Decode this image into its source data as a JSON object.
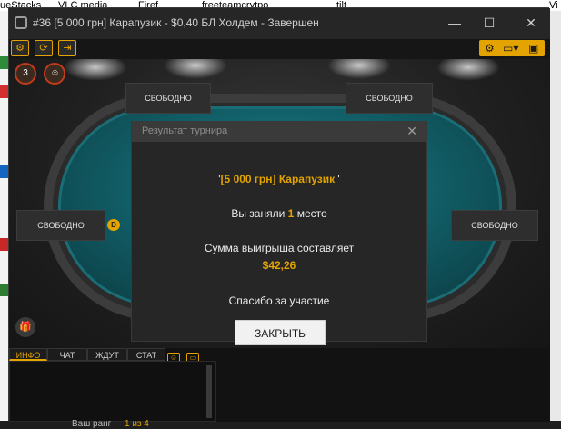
{
  "desktop": {
    "taskbar_items": [
      "ueStacks",
      "VLC media",
      "Firef",
      "freeteamcrytpo",
      "tilt",
      "Vi"
    ]
  },
  "window": {
    "title": "#36 [5 000 грн] Карапузик  - $0,40 БЛ Холдем - Завершен",
    "minimize": "—",
    "maximize": "☐",
    "close": "✕"
  },
  "toolbar": {
    "left_icons": [
      "gear-icon",
      "refresh-icon",
      "exit-icon"
    ],
    "right_icons": [
      "settings-icon",
      "layout-icon",
      "window-icon"
    ],
    "left_glyphs": [
      "⚙",
      "⟳",
      "⇥"
    ],
    "right_glyphs": [
      "⚙",
      "▭▾",
      "▣"
    ]
  },
  "table": {
    "seat_top_left": "СВОБОДНО",
    "seat_top_right": "СВОБОДНО",
    "seat_left": "СВОБОДНО",
    "seat_right": "СВОБОДНО",
    "dealer_label": "D",
    "badge_1": "3",
    "badge_2": "☺"
  },
  "modal": {
    "title": "Результат турнира",
    "close": "✕",
    "tournament_name": "[5 000 грн] Карапузик",
    "place_prefix": "Вы заняли",
    "place_value": "1",
    "place_suffix": "место",
    "prize_text": "Сумма выигрыша составляет",
    "prize_value": "$42,26",
    "thanks": "Спасибо за участие",
    "close_button": "ЗАКРЫТЬ"
  },
  "chat": {
    "tabs": [
      "ИНФО",
      "ЧАТ",
      "ЖДУТ",
      "СТАТ"
    ],
    "active_tab": "ИНФО",
    "rank_label": "Ваш ранг",
    "rank_value": "1 из 4"
  },
  "colors": {
    "accent": "#e3a300",
    "felt": "#1f8a94",
    "window_bg": "#1f1f1f"
  }
}
